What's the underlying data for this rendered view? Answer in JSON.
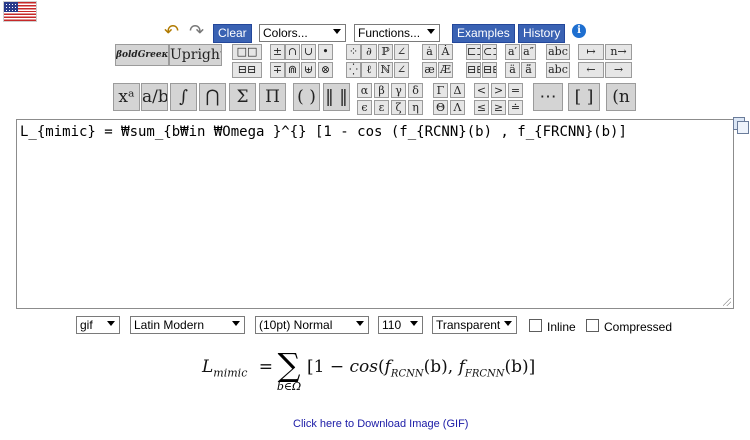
{
  "header": {
    "clear_label": "Clear",
    "colors_select": "Colors...",
    "functions_select": "Functions...",
    "examples_label": "Examples",
    "history_label": "History",
    "undo_icon": "undo-arrow-icon",
    "redo_icon": "redo-arrow-icon",
    "info_icon": "info-icon",
    "info_glyph": "i",
    "accent_color": "#3a62b3"
  },
  "toolbar": {
    "bold_greek_label": "βoldGreeκ",
    "upright_label": "Upright",
    "row1": [
      "□□",
      "±",
      "∩",
      "∪",
      "•",
      "⁘",
      "∂",
      "ℙ",
      "∠",
      "ȧ",
      "Ȧ",
      "⊏⊐",
      "⊂⊃",
      "a′",
      "a″",
      "abc",
      "↦",
      "n→"
    ],
    "row2": [
      "⊟⊟",
      "∓",
      "⋒",
      "⊎",
      "⊗",
      "⁛",
      "ℓ",
      "ℕ",
      "∠",
      "æ",
      "Æ",
      "⊟⊟",
      "⊟⊟",
      "ä",
      "ä̈",
      "abc",
      "←",
      "→"
    ],
    "large": [
      "xᵃ",
      "a/b",
      "∫",
      "⋂",
      "Σ",
      "Π",
      "( )",
      "‖ ‖",
      "⋯",
      "⁞",
      "[ ]",
      "(n r)"
    ],
    "greek": [
      "α",
      "β",
      "γ",
      "δ",
      "Γ",
      "Δ",
      "ϵ",
      "ε",
      "ζ",
      "η",
      "Θ",
      "Λ"
    ],
    "relations": [
      "<",
      ">",
      "=",
      "≤",
      "≥",
      "≐"
    ]
  },
  "editor": {
    "text": "L_{mimic} = ₩sum_{b₩in ₩Omega }^{} [1 - cos (f_{RCNN}(b) , f_{FRCNN}(b)]"
  },
  "options": {
    "format": "gif",
    "font": "Latin Modern",
    "size": "(10pt) Normal",
    "dpi": "110",
    "background": "Transparent",
    "inline_label": "Inline",
    "compressed_label": "Compressed"
  },
  "preview": {
    "lhs": "L",
    "lhs_sub": "mimic",
    "equals": "=",
    "sum_symbol": "∑",
    "sum_sub": "b∈Ω",
    "open": "[1 − ",
    "cos": "cos",
    "paren_open": "(",
    "f1": "f",
    "f1_sub": "RCNN",
    "arg1": "(b), ",
    "f2": "f",
    "f2_sub": "FRCNN",
    "arg2": "(b)]"
  },
  "download": {
    "label": "Click here to Download Image (GIF)"
  }
}
